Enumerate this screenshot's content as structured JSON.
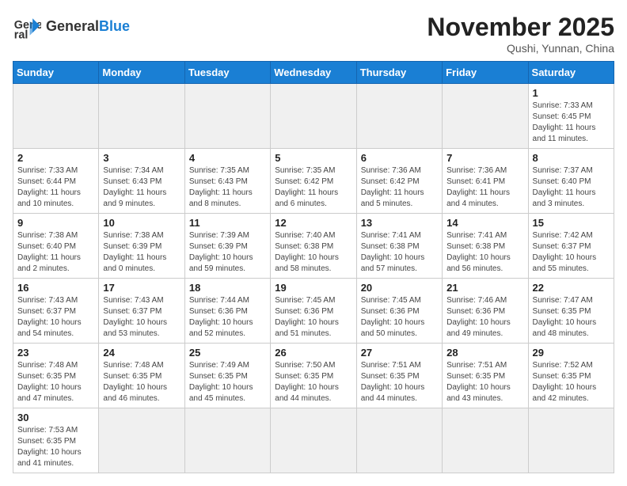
{
  "logo": {
    "text_general": "General",
    "text_blue": "Blue"
  },
  "header": {
    "month": "November 2025",
    "location": "Qushi, Yunnan, China"
  },
  "weekdays": [
    "Sunday",
    "Monday",
    "Tuesday",
    "Wednesday",
    "Thursday",
    "Friday",
    "Saturday"
  ],
  "weeks": [
    [
      {
        "day": "",
        "info": ""
      },
      {
        "day": "",
        "info": ""
      },
      {
        "day": "",
        "info": ""
      },
      {
        "day": "",
        "info": ""
      },
      {
        "day": "",
        "info": ""
      },
      {
        "day": "",
        "info": ""
      },
      {
        "day": "1",
        "info": "Sunrise: 7:33 AM\nSunset: 6:45 PM\nDaylight: 11 hours and 11 minutes."
      }
    ],
    [
      {
        "day": "2",
        "info": "Sunrise: 7:33 AM\nSunset: 6:44 PM\nDaylight: 11 hours and 10 minutes."
      },
      {
        "day": "3",
        "info": "Sunrise: 7:34 AM\nSunset: 6:43 PM\nDaylight: 11 hours and 9 minutes."
      },
      {
        "day": "4",
        "info": "Sunrise: 7:35 AM\nSunset: 6:43 PM\nDaylight: 11 hours and 8 minutes."
      },
      {
        "day": "5",
        "info": "Sunrise: 7:35 AM\nSunset: 6:42 PM\nDaylight: 11 hours and 6 minutes."
      },
      {
        "day": "6",
        "info": "Sunrise: 7:36 AM\nSunset: 6:42 PM\nDaylight: 11 hours and 5 minutes."
      },
      {
        "day": "7",
        "info": "Sunrise: 7:36 AM\nSunset: 6:41 PM\nDaylight: 11 hours and 4 minutes."
      },
      {
        "day": "8",
        "info": "Sunrise: 7:37 AM\nSunset: 6:40 PM\nDaylight: 11 hours and 3 minutes."
      }
    ],
    [
      {
        "day": "9",
        "info": "Sunrise: 7:38 AM\nSunset: 6:40 PM\nDaylight: 11 hours and 2 minutes."
      },
      {
        "day": "10",
        "info": "Sunrise: 7:38 AM\nSunset: 6:39 PM\nDaylight: 11 hours and 0 minutes."
      },
      {
        "day": "11",
        "info": "Sunrise: 7:39 AM\nSunset: 6:39 PM\nDaylight: 10 hours and 59 minutes."
      },
      {
        "day": "12",
        "info": "Sunrise: 7:40 AM\nSunset: 6:38 PM\nDaylight: 10 hours and 58 minutes."
      },
      {
        "day": "13",
        "info": "Sunrise: 7:41 AM\nSunset: 6:38 PM\nDaylight: 10 hours and 57 minutes."
      },
      {
        "day": "14",
        "info": "Sunrise: 7:41 AM\nSunset: 6:38 PM\nDaylight: 10 hours and 56 minutes."
      },
      {
        "day": "15",
        "info": "Sunrise: 7:42 AM\nSunset: 6:37 PM\nDaylight: 10 hours and 55 minutes."
      }
    ],
    [
      {
        "day": "16",
        "info": "Sunrise: 7:43 AM\nSunset: 6:37 PM\nDaylight: 10 hours and 54 minutes."
      },
      {
        "day": "17",
        "info": "Sunrise: 7:43 AM\nSunset: 6:37 PM\nDaylight: 10 hours and 53 minutes."
      },
      {
        "day": "18",
        "info": "Sunrise: 7:44 AM\nSunset: 6:36 PM\nDaylight: 10 hours and 52 minutes."
      },
      {
        "day": "19",
        "info": "Sunrise: 7:45 AM\nSunset: 6:36 PM\nDaylight: 10 hours and 51 minutes."
      },
      {
        "day": "20",
        "info": "Sunrise: 7:45 AM\nSunset: 6:36 PM\nDaylight: 10 hours and 50 minutes."
      },
      {
        "day": "21",
        "info": "Sunrise: 7:46 AM\nSunset: 6:36 PM\nDaylight: 10 hours and 49 minutes."
      },
      {
        "day": "22",
        "info": "Sunrise: 7:47 AM\nSunset: 6:35 PM\nDaylight: 10 hours and 48 minutes."
      }
    ],
    [
      {
        "day": "23",
        "info": "Sunrise: 7:48 AM\nSunset: 6:35 PM\nDaylight: 10 hours and 47 minutes."
      },
      {
        "day": "24",
        "info": "Sunrise: 7:48 AM\nSunset: 6:35 PM\nDaylight: 10 hours and 46 minutes."
      },
      {
        "day": "25",
        "info": "Sunrise: 7:49 AM\nSunset: 6:35 PM\nDaylight: 10 hours and 45 minutes."
      },
      {
        "day": "26",
        "info": "Sunrise: 7:50 AM\nSunset: 6:35 PM\nDaylight: 10 hours and 44 minutes."
      },
      {
        "day": "27",
        "info": "Sunrise: 7:51 AM\nSunset: 6:35 PM\nDaylight: 10 hours and 44 minutes."
      },
      {
        "day": "28",
        "info": "Sunrise: 7:51 AM\nSunset: 6:35 PM\nDaylight: 10 hours and 43 minutes."
      },
      {
        "day": "29",
        "info": "Sunrise: 7:52 AM\nSunset: 6:35 PM\nDaylight: 10 hours and 42 minutes."
      }
    ],
    [
      {
        "day": "30",
        "info": "Sunrise: 7:53 AM\nSunset: 6:35 PM\nDaylight: 10 hours and 41 minutes."
      },
      {
        "day": "",
        "info": ""
      },
      {
        "day": "",
        "info": ""
      },
      {
        "day": "",
        "info": ""
      },
      {
        "day": "",
        "info": ""
      },
      {
        "day": "",
        "info": ""
      },
      {
        "day": "",
        "info": ""
      }
    ]
  ]
}
